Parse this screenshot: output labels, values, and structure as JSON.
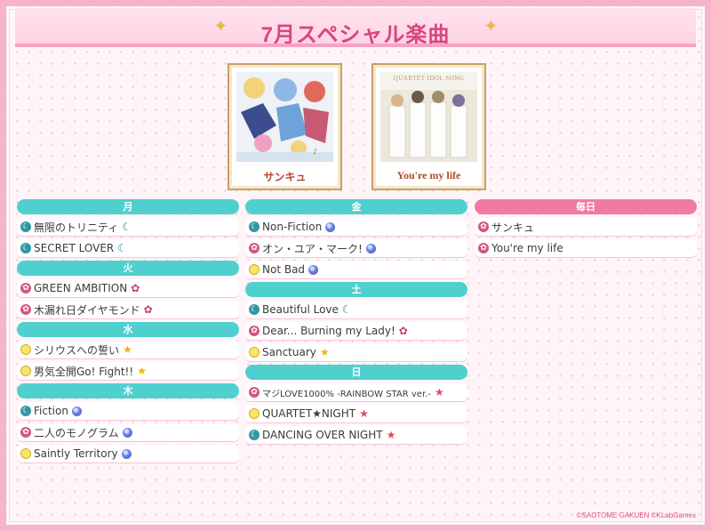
{
  "title": "7月スペシャル楽曲",
  "jackets": [
    {
      "caption": "サンキュ"
    },
    {
      "caption": "You're my life",
      "art_text": "QUARTET IDOL SONG"
    }
  ],
  "columns": [
    {
      "groups": [
        {
          "day": "月",
          "songs": [
            {
              "title": "無限のトリニティ",
              "lead_icon": "moon-circle-icon",
              "tail_icon": "moon-icon"
            },
            {
              "title": "SECRET LOVER",
              "lead_icon": "moon-circle-icon",
              "tail_icon": "moon-icon"
            }
          ]
        },
        {
          "day": "火",
          "songs": [
            {
              "title": "GREEN AMBITION",
              "lead_icon": "flower-circle-icon",
              "tail_icon": "flower-icon"
            },
            {
              "title": "木漏れ日ダイヤモンド",
              "lead_icon": "flower-circle-icon",
              "tail_icon": "flower-icon"
            }
          ]
        },
        {
          "day": "水",
          "songs": [
            {
              "title": "シリウスへの誓い",
              "lead_icon": "sun-circle-icon",
              "tail_icon": "star-icon"
            },
            {
              "title": "男気全開Go! Fight!!",
              "lead_icon": "sun-circle-icon",
              "tail_icon": "star-icon"
            }
          ]
        },
        {
          "day": "木",
          "songs": [
            {
              "title": "Fiction",
              "lead_icon": "moon-circle-icon",
              "tail_icon": "disc-icon"
            },
            {
              "title": "二人のモノグラム",
              "lead_icon": "flower-circle-icon",
              "tail_icon": "disc-icon"
            },
            {
              "title": "Saintly Territory",
              "lead_icon": "sun-circle-icon",
              "tail_icon": "disc-icon"
            }
          ]
        }
      ]
    },
    {
      "groups": [
        {
          "day": "金",
          "songs": [
            {
              "title": "Non-Fiction",
              "lead_icon": "moon-circle-icon",
              "tail_icon": "disc-icon"
            },
            {
              "title": "オン・ユア・マーク!",
              "lead_icon": "flower-circle-icon",
              "tail_icon": "disc-icon"
            },
            {
              "title": "Not Bad",
              "lead_icon": "sun-circle-icon",
              "tail_icon": "disc-icon"
            }
          ]
        },
        {
          "day": "土",
          "songs": [
            {
              "title": "Beautiful Love",
              "lead_icon": "moon-circle-icon",
              "tail_icon": "moon-icon"
            },
            {
              "title": "Dear... Burning my Lady!",
              "lead_icon": "flower-circle-icon",
              "tail_icon": "flower-icon"
            },
            {
              "title": "Sanctuary",
              "lead_icon": "sun-circle-icon",
              "tail_icon": "star-icon"
            }
          ]
        },
        {
          "day": "日",
          "songs": [
            {
              "title": "マジLOVE1000% -RAINBOW STAR ver.-",
              "lead_icon": "flower-circle-icon",
              "tail_icon": "red-star-icon",
              "small": true
            },
            {
              "title": "QUARTET★NIGHT",
              "lead_icon": "sun-circle-icon",
              "tail_icon": "red-star-icon"
            },
            {
              "title": "DANCING OVER NIGHT",
              "lead_icon": "moon-circle-icon",
              "tail_icon": "red-star-icon"
            }
          ]
        }
      ]
    },
    {
      "groups": [
        {
          "day": "毎日",
          "accent": "pink",
          "songs": [
            {
              "title": "サンキュ",
              "lead_icon": "flower-circle-icon",
              "tail_icon": ""
            },
            {
              "title": "You're my life",
              "lead_icon": "flower-circle-icon",
              "tail_icon": ""
            }
          ]
        }
      ]
    }
  ],
  "copyright": "©SAOTOME GAKUEN ©KLabGames",
  "colors": {
    "accent_pink": "#f07aa5",
    "accent_teal": "#4fd0cf",
    "title_pink": "#d9457e"
  }
}
